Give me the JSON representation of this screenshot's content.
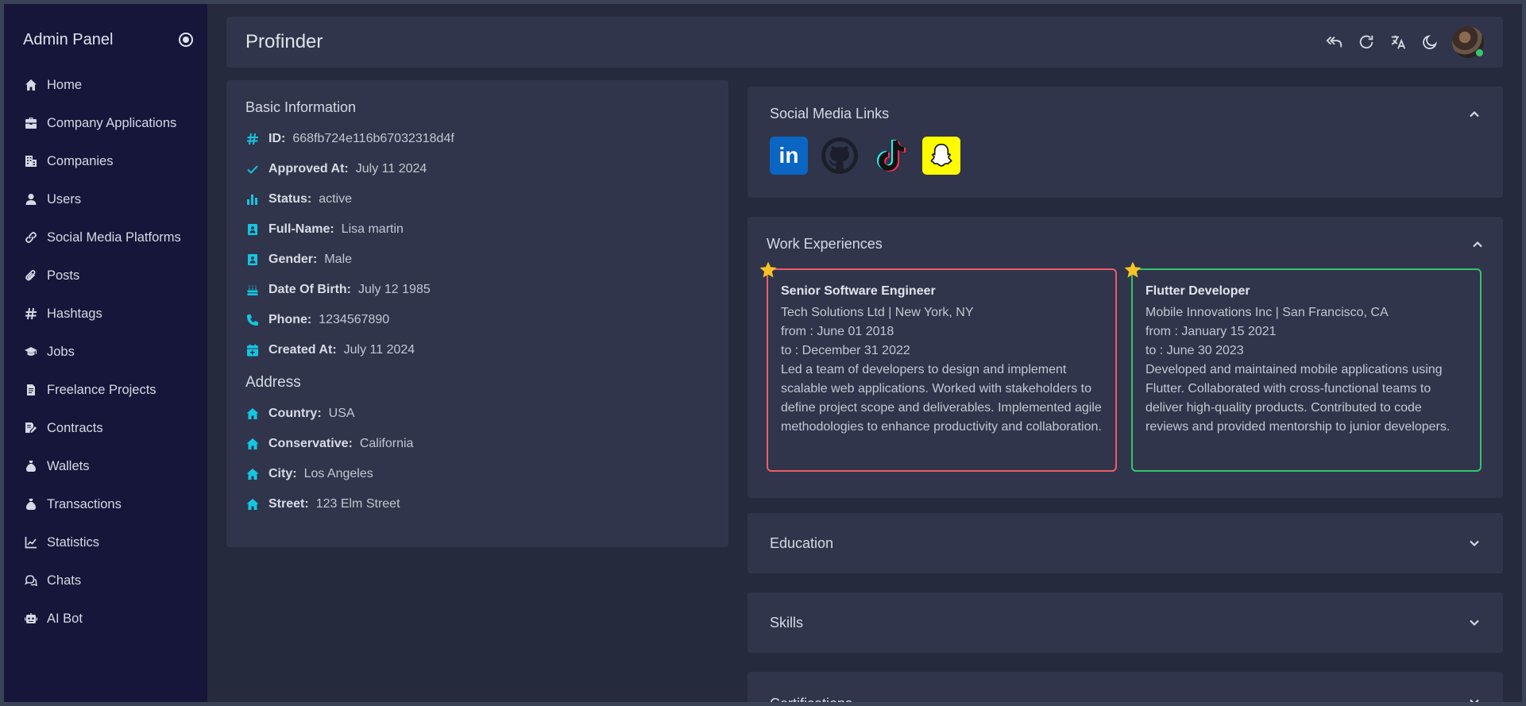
{
  "sidebar": {
    "title": "Admin Panel",
    "items": [
      {
        "label": "Home",
        "icon": "home-icon"
      },
      {
        "label": "Company Applications",
        "icon": "briefcase-icon"
      },
      {
        "label": "Companies",
        "icon": "building-icon"
      },
      {
        "label": "Users",
        "icon": "user-icon"
      },
      {
        "label": "Social Media Platforms",
        "icon": "link-icon"
      },
      {
        "label": "Posts",
        "icon": "paperclip-icon"
      },
      {
        "label": "Hashtags",
        "icon": "hashtag-icon"
      },
      {
        "label": "Jobs",
        "icon": "graduation-cap-icon"
      },
      {
        "label": "Freelance Projects",
        "icon": "file-icon"
      },
      {
        "label": "Contracts",
        "icon": "contract-icon"
      },
      {
        "label": "Wallets",
        "icon": "money-bag-icon"
      },
      {
        "label": "Transactions",
        "icon": "money-bag-icon"
      },
      {
        "label": "Statistics",
        "icon": "chart-line-icon"
      },
      {
        "label": "Chats",
        "icon": "chat-icon"
      },
      {
        "label": "AI Bot",
        "icon": "robot-icon"
      }
    ]
  },
  "header": {
    "title": "Profinder"
  },
  "basic": {
    "title": "Basic Information",
    "rows": [
      {
        "key": "ID:",
        "value": "668fb724e116b67032318d4f",
        "icon": "hashtag-icon"
      },
      {
        "key": "Approved At:",
        "value": "July 11 2024",
        "icon": "check-icon"
      },
      {
        "key": "Status:",
        "value": "active",
        "icon": "bar-chart-icon"
      },
      {
        "key": "Full-Name:",
        "value": "Lisa martin",
        "icon": "id-card-icon"
      },
      {
        "key": "Gender:",
        "value": "Male",
        "icon": "id-card-icon"
      },
      {
        "key": "Date Of Birth:",
        "value": "July 12 1985",
        "icon": "cake-icon"
      },
      {
        "key": "Phone:",
        "value": "1234567890",
        "icon": "phone-icon"
      },
      {
        "key": "Created At:",
        "value": "July 11 2024",
        "icon": "calendar-icon"
      }
    ],
    "address_title": "Address",
    "address": [
      {
        "key": "Country:",
        "value": "USA"
      },
      {
        "key": "Conservative:",
        "value": "California"
      },
      {
        "key": "City:",
        "value": "Los Angeles"
      },
      {
        "key": "Street:",
        "value": "123 Elm Street"
      }
    ]
  },
  "social": {
    "title": "Social Media Links",
    "links": [
      {
        "name": "linkedin-icon",
        "text": "in"
      },
      {
        "name": "github-icon"
      },
      {
        "name": "tiktok-icon"
      },
      {
        "name": "snapchat-icon"
      }
    ]
  },
  "work": {
    "title": "Work Experiences",
    "items": [
      {
        "title": "Senior Software Engineer",
        "company": "Tech Solutions Ltd | New York, NY",
        "from": "from : June 01 2018",
        "to": "to : December 31 2022",
        "desc": "Led a team of developers to design and implement scalable web applications. Worked with stakeholders to define project scope and deliverables. Implemented agile methodologies to enhance productivity and collaboration.",
        "border_color": "#ee5c67"
      },
      {
        "title": "Flutter Developer",
        "company": "Mobile Innovations Inc | San Francisco, CA",
        "from": "from : January 15 2021",
        "to": "to : June 30 2023",
        "desc": "Developed and maintained mobile applications using Flutter. Collaborated with cross-functional teams to deliver high-quality products. Contributed to code reviews and provided mentorship to junior developers.",
        "border_color": "#35c46a"
      }
    ]
  },
  "sections": {
    "education": "Education",
    "skills": "Skills",
    "certifications": "Certifications"
  },
  "colors": {
    "accent": "#14c6e2",
    "star": "#f7c325",
    "online": "#37c66b"
  }
}
